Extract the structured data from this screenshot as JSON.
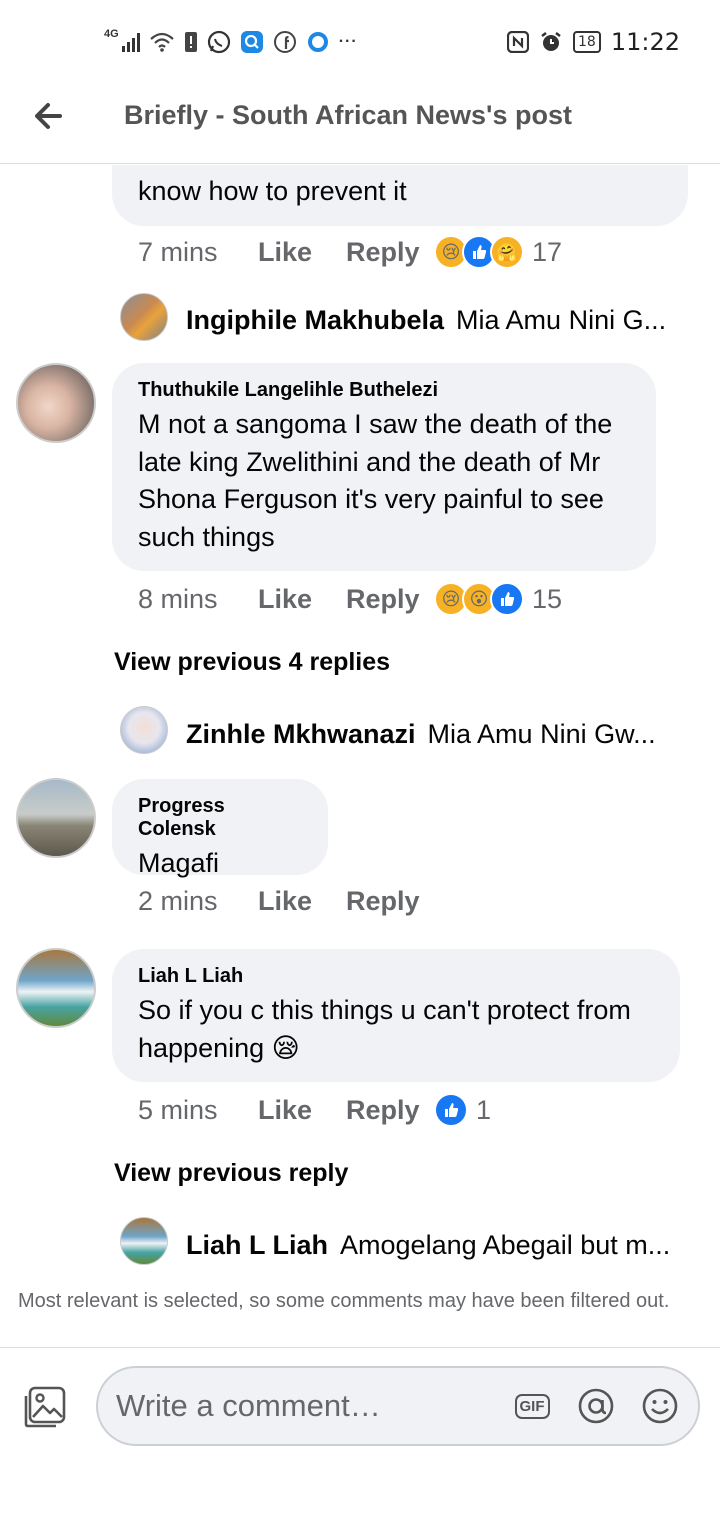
{
  "status_bar": {
    "network": "4G",
    "battery": "18",
    "time": "11:22"
  },
  "header": {
    "title": "Briefly - South African News's post"
  },
  "comments": [
    {
      "text": "know how to prevent it",
      "time": "7 mins",
      "like": "Like",
      "reply": "Reply",
      "reaction_icons": [
        "sad",
        "like",
        "care"
      ],
      "reaction_count": "17",
      "reply_preview": {
        "name": "Ingiphile Makhubela",
        "text": "Mia Amu Nini G..."
      }
    },
    {
      "author": "Thuthukile Langelihle Buthelezi",
      "text": "M not a sangoma I saw the death of the late king Zwelithini and the death of Mr Shona Ferguson it's very painful to see such things",
      "time": "8 mins",
      "like": "Like",
      "reply": "Reply",
      "reaction_icons": [
        "sad",
        "wow",
        "like"
      ],
      "reaction_count": "15",
      "view_previous": "View previous 4 replies",
      "reply_preview": {
        "name": "Zinhle Mkhwanazi",
        "text": "Mia Amu Nini Gw..."
      }
    },
    {
      "author": "Progress Colensk",
      "text": "Magafi",
      "time": "2 mins",
      "like": "Like",
      "reply": "Reply"
    },
    {
      "author": "Liah L Liah",
      "text": "So if you c this things u can't protect from happening 😪",
      "time": "5 mins",
      "like": "Like",
      "reply": "Reply",
      "reaction_icons": [
        "like"
      ],
      "reaction_count": "1",
      "view_previous": "View previous reply",
      "reply_preview": {
        "name": "Liah L Liah",
        "text": "Amogelang Abegail but m..."
      }
    }
  ],
  "filter_note": "Most relevant is selected, so some comments may have been filtered out.",
  "composer": {
    "placeholder": "Write a comment…",
    "gif_label": "GIF"
  }
}
